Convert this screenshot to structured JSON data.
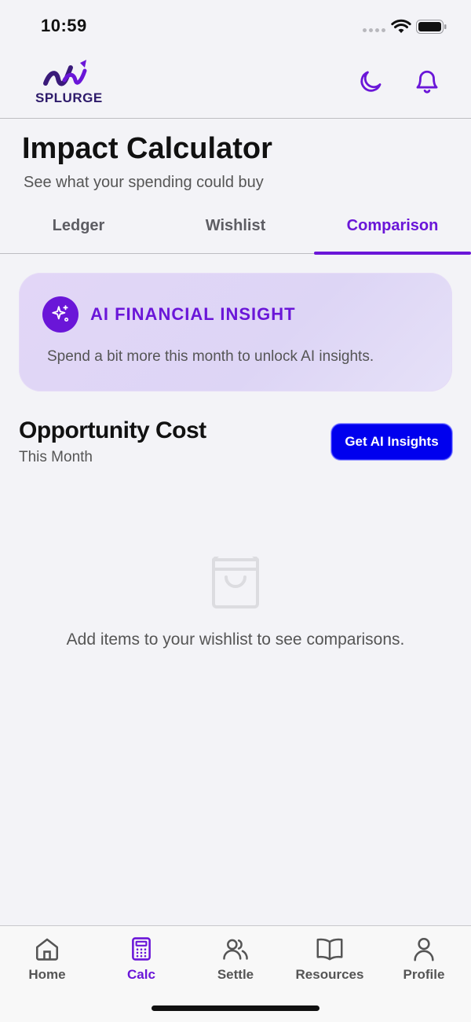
{
  "status_bar": {
    "time": "10:59"
  },
  "header": {
    "logo_text": "SPLURGE"
  },
  "page": {
    "title": "Impact Calculator",
    "subtitle": "See what your spending could buy"
  },
  "tabs": [
    {
      "label": "Ledger",
      "active": false
    },
    {
      "label": "Wishlist",
      "active": false
    },
    {
      "label": "Comparison",
      "active": true
    }
  ],
  "insight": {
    "title": "AI FINANCIAL INSIGHT",
    "text": "Spend a bit more this month to unlock AI insights."
  },
  "opportunity": {
    "title": "Opportunity Cost",
    "period": "This Month",
    "button_label": "Get AI Insights"
  },
  "empty_state": {
    "icon": "shopping-bag-icon",
    "text": "Add items to your wishlist to see comparisons."
  },
  "bottom_nav": [
    {
      "label": "Home",
      "icon": "home-icon",
      "active": false
    },
    {
      "label": "Calc",
      "icon": "calculator-icon",
      "active": true
    },
    {
      "label": "Settle",
      "icon": "users-icon",
      "active": false
    },
    {
      "label": "Resources",
      "icon": "book-icon",
      "active": false
    },
    {
      "label": "Profile",
      "icon": "user-icon",
      "active": false
    }
  ],
  "colors": {
    "accent": "#6a16d8",
    "button": "#0000ee",
    "background": "#f3f3f7",
    "insight_card": "#e2d6f7"
  }
}
